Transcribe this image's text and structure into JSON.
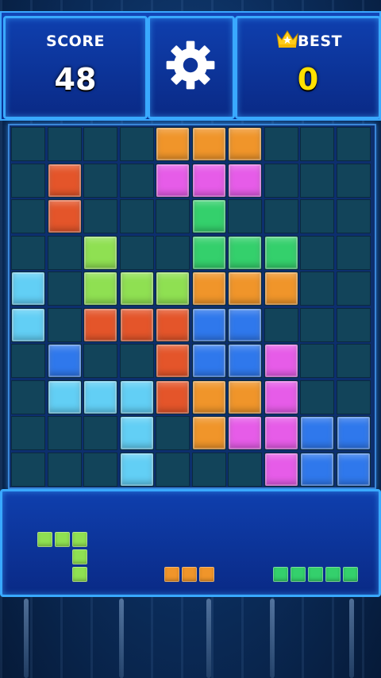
{
  "header": {
    "score_label": "SCORE",
    "score_value": "48",
    "best_label": "BEST",
    "best_value": "0",
    "settings_icon": "gear-icon",
    "best_icon": "crown-icon"
  },
  "colors": {
    "orange": "#f0952a",
    "magenta": "#e65ce8",
    "red": "#e4552a",
    "green": "#34d06c",
    "lime": "#8fe052",
    "cyan": "#62cff5",
    "blue": "#2f78ec",
    "empty": "#12445a"
  },
  "board": {
    "rows": 10,
    "cols": 10,
    "grid": [
      [
        "",
        "",
        "",
        "",
        "orange",
        "orange",
        "orange",
        "",
        "",
        ""
      ],
      [
        "",
        "red",
        "",
        "",
        "magenta",
        "magenta",
        "magenta",
        "",
        "",
        ""
      ],
      [
        "",
        "red",
        "",
        "",
        "",
        "green",
        "",
        "",
        "",
        ""
      ],
      [
        "",
        "",
        "lime",
        "",
        "",
        "green",
        "green",
        "green",
        "",
        ""
      ],
      [
        "cyan",
        "",
        "lime",
        "lime",
        "lime",
        "orange",
        "orange",
        "orange",
        "",
        ""
      ],
      [
        "cyan",
        "",
        "red",
        "red",
        "red",
        "blue",
        "blue",
        "",
        "",
        ""
      ],
      [
        "",
        "blue",
        "",
        "",
        "red",
        "blue",
        "blue",
        "magenta",
        "",
        ""
      ],
      [
        "",
        "cyan",
        "cyan",
        "cyan",
        "red",
        "orange",
        "orange",
        "magenta",
        "",
        ""
      ],
      [
        "",
        "",
        "",
        "cyan",
        "",
        "orange",
        "magenta",
        "magenta",
        "blue",
        "blue"
      ],
      [
        "",
        "",
        "",
        "cyan",
        "",
        "",
        "",
        "magenta",
        "blue",
        "blue"
      ]
    ]
  },
  "tray": {
    "pieces": [
      {
        "name": "next-piece-j",
        "color": "lime",
        "cells": [
          [
            0,
            0
          ],
          [
            0,
            1
          ],
          [
            0,
            2
          ],
          [
            1,
            2
          ],
          [
            2,
            2
          ]
        ]
      },
      {
        "name": "next-piece-i3",
        "color": "orange",
        "cells": [
          [
            0,
            0
          ],
          [
            0,
            1
          ],
          [
            0,
            2
          ]
        ]
      },
      {
        "name": "next-piece-i5",
        "color": "green",
        "cells": [
          [
            0,
            0
          ],
          [
            0,
            1
          ],
          [
            0,
            2
          ],
          [
            0,
            3
          ],
          [
            0,
            4
          ]
        ]
      }
    ]
  }
}
